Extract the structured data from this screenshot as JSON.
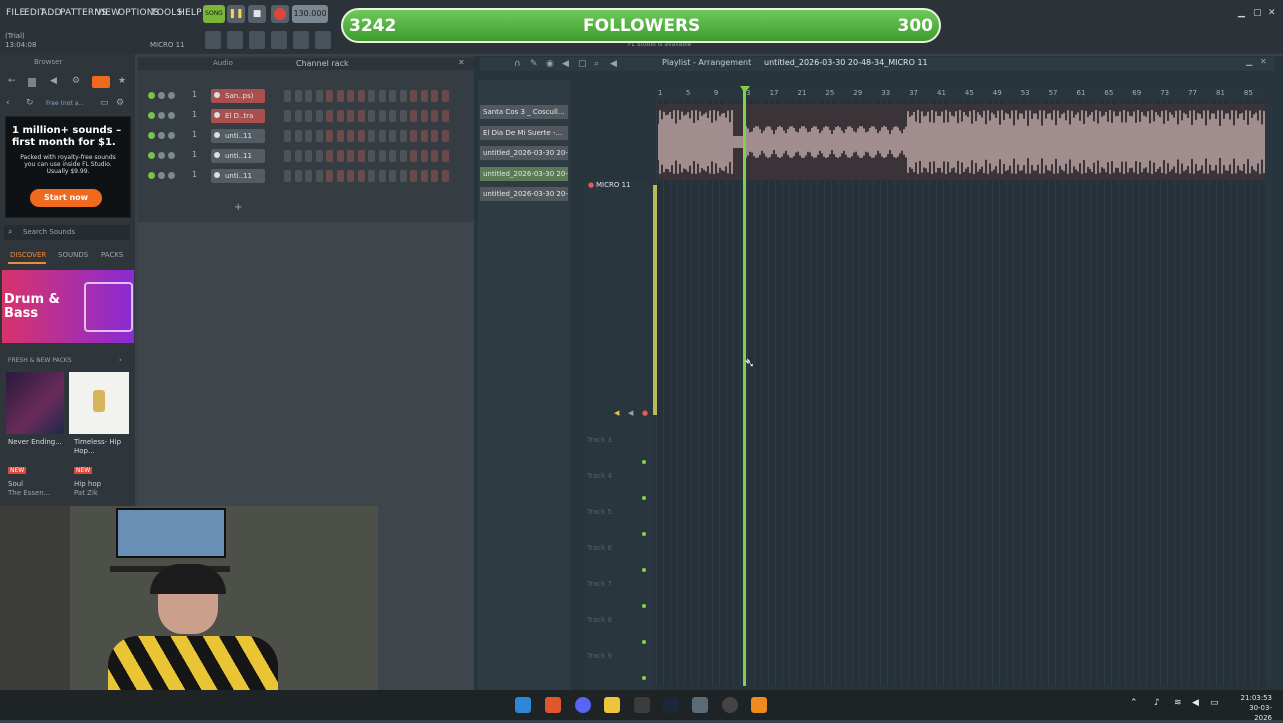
{
  "menu": [
    "FILE",
    "EDIT",
    "ADD",
    "PATTERNS",
    "VIEW",
    "OPTIONS",
    "TOOLS",
    "HELP"
  ],
  "transport": {
    "mode": "SONG",
    "tempo": "130.000"
  },
  "info": {
    "trial": "(Trial)",
    "time": "13:04:08",
    "channel": "MICRO 11",
    "hint": "FL Studio is available"
  },
  "followers": {
    "current": "3242",
    "label": "FOLLOWERS",
    "goal": "300"
  },
  "browser": {
    "title": "Browser",
    "free_badge": "Free (not a...",
    "ad": {
      "headline": "1 million+ sounds – first month for $1.",
      "body": "Packed with royalty-free sounds you can use inside FL Studio. Usually $9.99.",
      "cta": "Start now"
    },
    "search_placeholder": "Search Sounds",
    "tabs": [
      "DISCOVER",
      "SOUNDS",
      "PACKS"
    ],
    "banner": "Drum & Bass",
    "section": "FRESH & NEW PACKS",
    "packs": [
      {
        "title": "Never Ending...",
        "badge": "NEW",
        "genre": "Soul",
        "author": "The Essen..."
      },
      {
        "title": "Timeless- Hip Hop...",
        "badge": "NEW",
        "genre": "Hip hop",
        "author": "Pat Zik"
      }
    ]
  },
  "channel_rack": {
    "tab_audio": "Audio",
    "title": "Channel rack",
    "channels": [
      {
        "num": "1",
        "name": "San..ps)"
      },
      {
        "num": "1",
        "name": "El D..tra"
      },
      {
        "num": "1",
        "name": "unti..11"
      },
      {
        "num": "1",
        "name": "unti..11"
      },
      {
        "num": "1",
        "name": "unti..11"
      }
    ]
  },
  "playlist": {
    "title": "Playlist - Arrangement",
    "project": "untitled_2026-03-30 20-48-34_MICRO 11",
    "patterns": [
      "Santa Cos 3 _ Coscull...",
      "El Dia De Mi Suerte -...",
      "untitled_2026-03-30 20-",
      "untitled_2026-03-30 20-",
      "untitled_2026-03-30 20-"
    ],
    "micro_track": "MICRO 11",
    "tracks": [
      "Track 3",
      "Track 4",
      "Track 5",
      "Track 6",
      "Track 7",
      "Track 8",
      "Track 9"
    ],
    "ruler": [
      "1",
      "5",
      "9",
      "13",
      "17",
      "21",
      "25",
      "29",
      "33",
      "37",
      "41",
      "45",
      "49",
      "53",
      "57",
      "61",
      "65",
      "69",
      "73",
      "77",
      "81",
      "85"
    ]
  },
  "taskbar": {
    "time": "21:03:53",
    "date": "30-03-2026"
  },
  "colors": {
    "accent_green": "#7fd24a",
    "record_red": "#e0453b",
    "ad_orange": "#ef6a1f"
  }
}
